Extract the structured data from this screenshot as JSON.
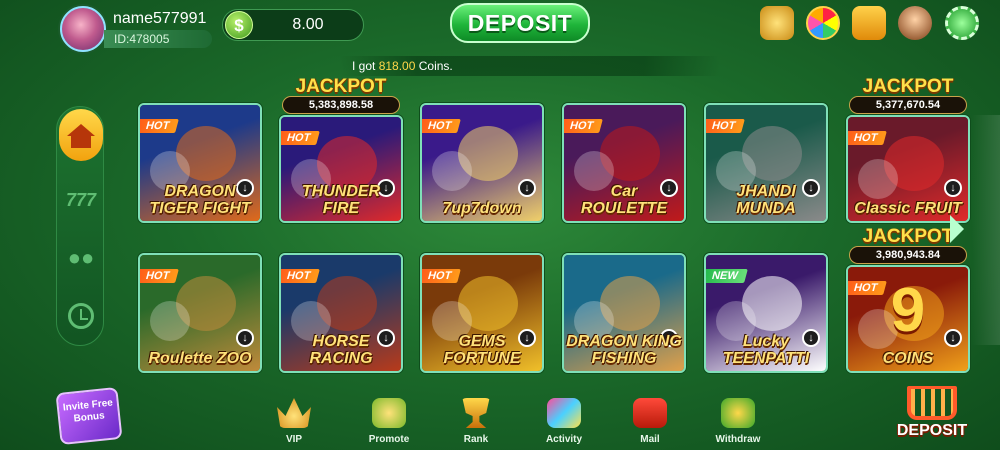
{
  "header": {
    "username": "name577991",
    "user_id": "ID:478005",
    "balance": "8.00",
    "coin_symbol": "$",
    "deposit_label": "DEPOSIT"
  },
  "marquee": {
    "prefix": "I got",
    "amount": "818.00",
    "suffix": "Coins."
  },
  "top_icons": [
    "gift-icon",
    "lucky-wheel-icon",
    "check-in-icon",
    "support-icon",
    "settings-icon"
  ],
  "left_nav": {
    "items": [
      "home",
      "slots",
      "users",
      "history"
    ],
    "slots_glyph": "777"
  },
  "games": [
    {
      "title": "DRAGON TIGER FIGHT",
      "tag": "HOT",
      "jackpot": null,
      "jackpot_value": null,
      "colors": [
        "#1d3a8a",
        "#e06a1a"
      ]
    },
    {
      "title": "THUNDER FIRE",
      "tag": "HOT",
      "jackpot": "JACKPOT",
      "jackpot_value": "5,383,898.58",
      "colors": [
        "#2a1a7a",
        "#e02a2a"
      ]
    },
    {
      "title": "7up7down",
      "tag": "HOT",
      "jackpot": null,
      "jackpot_value": null,
      "colors": [
        "#3a1a8a",
        "#f0d06a"
      ]
    },
    {
      "title": "Car ROULETTE",
      "tag": "HOT",
      "jackpot": null,
      "jackpot_value": null,
      "colors": [
        "#4a1a5a",
        "#c01a1a"
      ]
    },
    {
      "title": "JHANDI MUNDA",
      "tag": "HOT",
      "jackpot": null,
      "jackpot_value": null,
      "colors": [
        "#1a5a4a",
        "#8a8a8a"
      ]
    },
    {
      "title": "Classic FRUIT",
      "tag": "HOT",
      "jackpot": "JACKPOT",
      "jackpot_value": "5,377,670.54",
      "colors": [
        "#6a1a2a",
        "#e02a2a"
      ]
    },
    {
      "title": "Roulette ZOO",
      "tag": "HOT",
      "jackpot": null,
      "jackpot_value": null,
      "colors": [
        "#2a6a2a",
        "#c08a3a"
      ]
    },
    {
      "title": "HORSE RACING",
      "tag": "HOT",
      "jackpot": null,
      "jackpot_value": null,
      "colors": [
        "#1a3a6a",
        "#b83a1a"
      ]
    },
    {
      "title": "GEMS FORTUNE",
      "tag": "HOT",
      "jackpot": null,
      "jackpot_value": null,
      "colors": [
        "#7a3a0a",
        "#f0c02a"
      ]
    },
    {
      "title": "DRAGON KING FISHING",
      "tag": null,
      "jackpot": null,
      "jackpot_value": null,
      "colors": [
        "#1a6a8a",
        "#e0a04a"
      ]
    },
    {
      "title": "Lucky TEENPATTI",
      "tag": "NEW",
      "jackpot": null,
      "jackpot_value": null,
      "colors": [
        "#3a1a6a",
        "#ffffff"
      ]
    },
    {
      "title": "COINS",
      "tag": "HOT",
      "jackpot": "JACKPOT",
      "jackpot_value": "3,980,943.84",
      "colors": [
        "#8a1a0a",
        "#f0a01a"
      ],
      "big_digit": "9"
    }
  ],
  "bottom_nav": {
    "invite_label": "Invite Free Bonus",
    "items": [
      {
        "label": "VIP",
        "icon": "crown-icon"
      },
      {
        "label": "Promote",
        "icon": "coins-stack-icon"
      },
      {
        "label": "Rank",
        "icon": "trophy-icon"
      },
      {
        "label": "Activity",
        "icon": "gift-box-icon"
      },
      {
        "label": "Mail",
        "icon": "mailbox-icon"
      },
      {
        "label": "Withdraw",
        "icon": "withdraw-icon"
      }
    ],
    "deposit_label": "DEPOSIT"
  }
}
